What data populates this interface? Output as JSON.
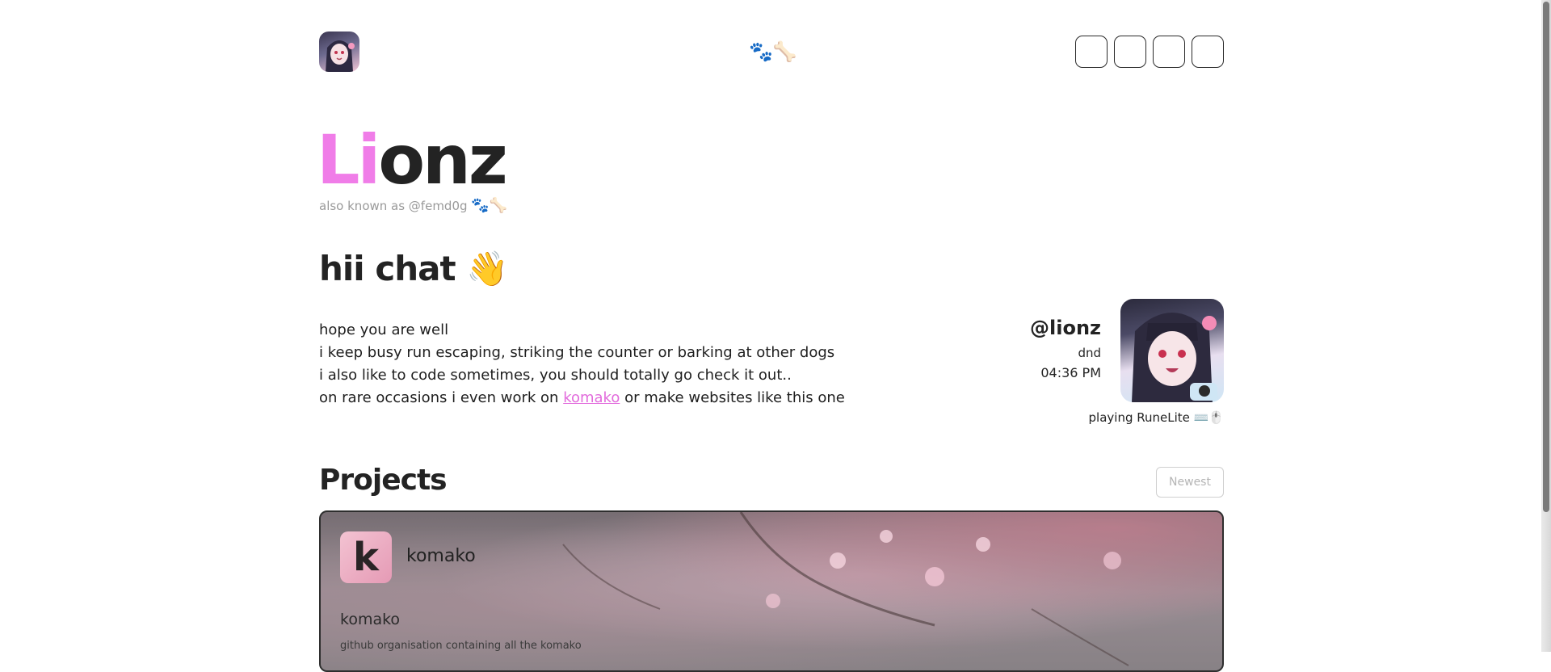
{
  "header": {
    "center_emoji": "🐾🦴",
    "nav_count": 4
  },
  "hero": {
    "name_highlight": "Li",
    "name_rest": "onz",
    "aka": "also known as @femd0g",
    "aka_emoji": "🐾🦴",
    "greeting": "hii chat",
    "greeting_emoji": "👋",
    "bio": {
      "line1": "hope you are well",
      "line2": "i keep busy run escaping, striking the counter or barking at other dogs",
      "line3": "i also like to code sometimes, you should totally go check it out..",
      "line4_pre": "on rare occasions i even work on ",
      "line4_link": "komako",
      "line4_post": " or make websites like this one"
    }
  },
  "profile": {
    "handle": "@lionz",
    "status": "dnd",
    "time": "04:36 PM",
    "activity": "playing RuneLite ⌨️🖱️"
  },
  "projects": {
    "title": "Projects",
    "sort_label": "Newest",
    "items": [
      {
        "icon_letter": "k",
        "name": "komako",
        "subtitle": "komako",
        "description": "github organisation containing all the komako"
      }
    ]
  },
  "colors": {
    "accent_pink": "#f07de8",
    "text_dark": "#232323",
    "muted": "#9a9a9a"
  }
}
